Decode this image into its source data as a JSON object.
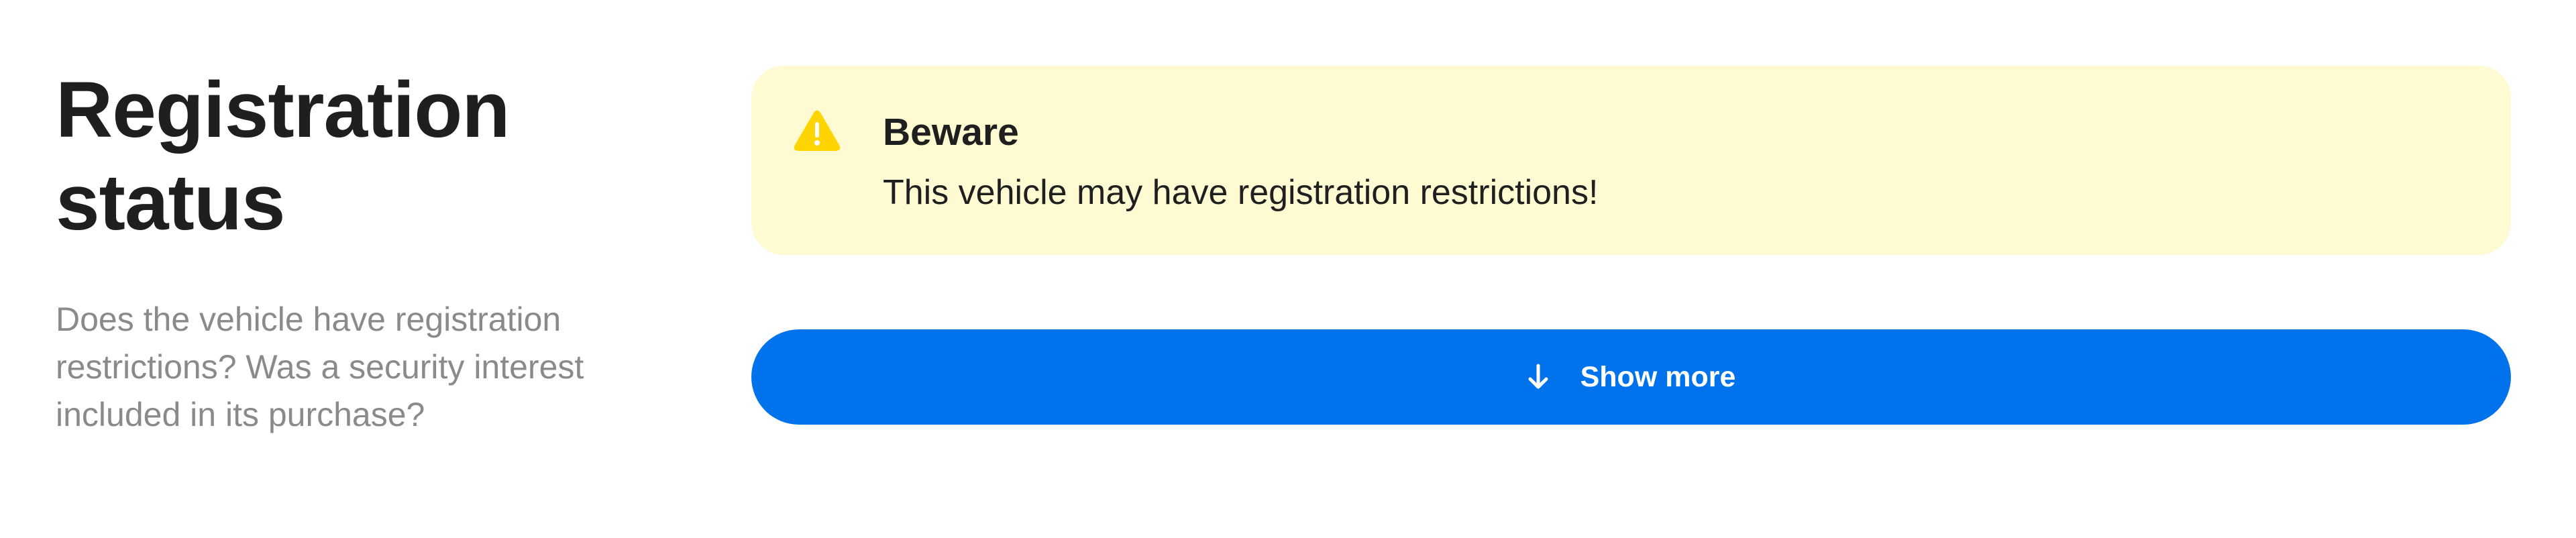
{
  "section": {
    "title_line1": "Registration",
    "title_line2": "status",
    "description": "Does the vehicle have registration restrictions? Was a security interest included in its purchase?"
  },
  "alert": {
    "icon": "warning-triangle-icon",
    "title": "Beware",
    "message": "This vehicle may have registration restrictions!",
    "background_color": "#fefad2",
    "icon_color": "#ffd400"
  },
  "show_more": {
    "icon": "arrow-down-icon",
    "label": "Show more",
    "color": "#0073ec"
  }
}
